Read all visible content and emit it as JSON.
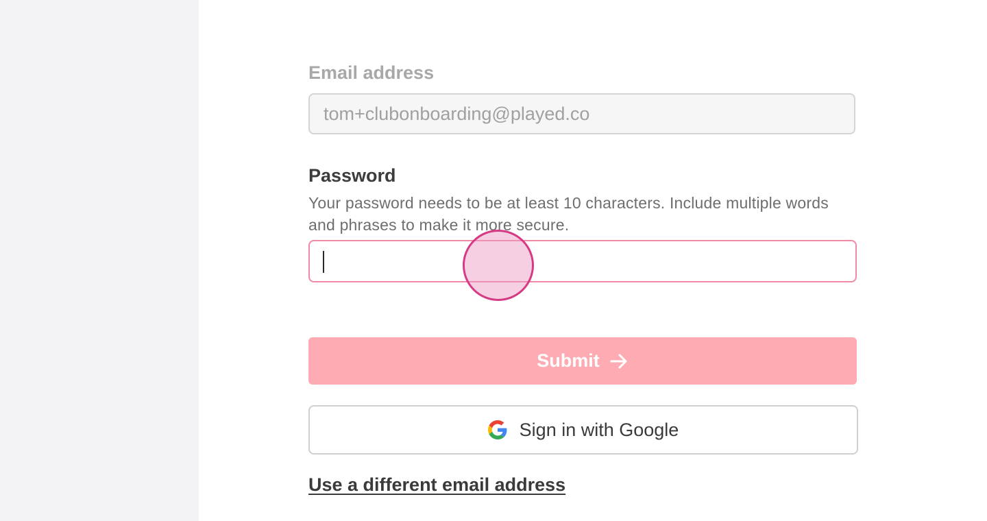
{
  "form": {
    "email_label": "Email address",
    "email_value": "tom+clubonboarding@played.co",
    "password_label": "Password",
    "password_help": "Your password needs to be at least 10 characters. Include multiple words and phrases to make it more secure.",
    "password_value": "",
    "submit_label": "Submit",
    "google_label": "Sign in with Google",
    "alt_link": "Use a different email address"
  },
  "icons": {
    "submit": "arrow-right-icon",
    "google": "google-icon"
  },
  "colors": {
    "accent": "#ffabb4",
    "focus_border": "#f08aa4",
    "click_marker": "#d63a85"
  }
}
